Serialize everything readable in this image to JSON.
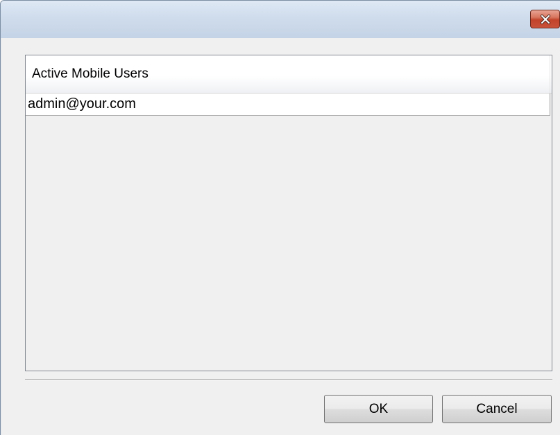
{
  "window": {
    "close_icon": "close-icon"
  },
  "table": {
    "columns": [
      "Active Mobile Users"
    ],
    "rows": [
      [
        "admin@your.com"
      ]
    ]
  },
  "buttons": {
    "ok_label": "OK",
    "cancel_label": "Cancel"
  },
  "colors": {
    "close_button": "#c24329",
    "titlebar": "#cfdcec",
    "dialog_background": "#f0f0f0"
  }
}
